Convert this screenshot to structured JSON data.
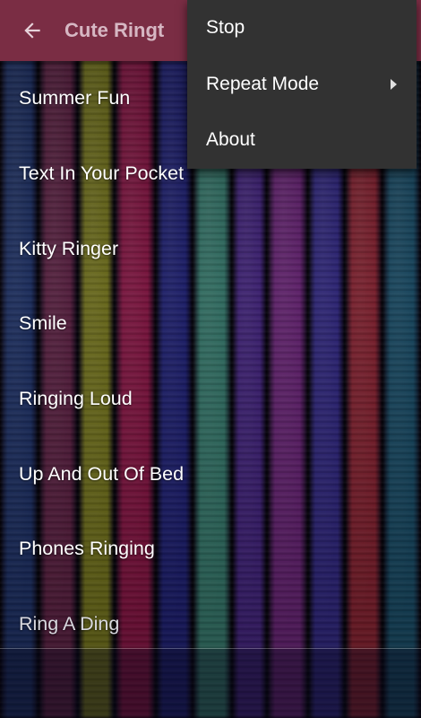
{
  "app_bar": {
    "title": "Cute Ringt",
    "background_color": "#7a2d44"
  },
  "background": {
    "plank_colors": [
      "#233a7a",
      "#6e2750",
      "#8a8a22",
      "#a01850",
      "#24268a",
      "#3f8f80",
      "#4f2a95",
      "#7c2a8c",
      "#3a2f9a",
      "#a0283a",
      "#1d5a7a"
    ]
  },
  "ringtones": [
    "Summer Fun",
    "Text In Your Pocket",
    "Kitty Ringer",
    "Smile",
    "Ringing Loud",
    "Up And Out Of Bed",
    "Phones Ringing",
    "Ring A Ding"
  ],
  "overflow_menu": {
    "items": [
      {
        "label": "Stop",
        "has_submenu": false
      },
      {
        "label": "Repeat Mode",
        "has_submenu": true
      },
      {
        "label": "About",
        "has_submenu": false
      }
    ]
  }
}
